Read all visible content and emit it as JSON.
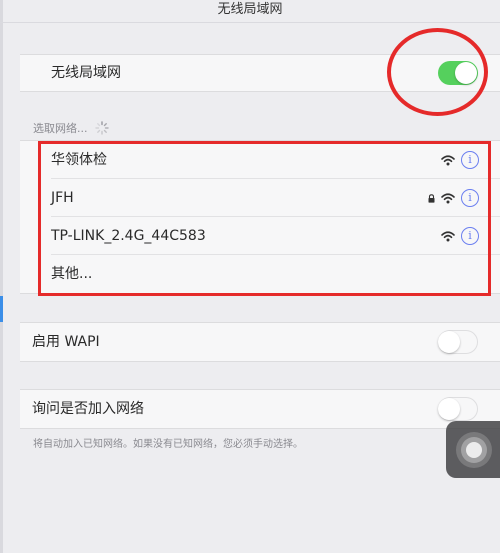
{
  "nav": {
    "title": "无线局域网"
  },
  "wifi_toggle": {
    "label": "无线局域网",
    "on": true
  },
  "networks_section": {
    "header": "选取网络..."
  },
  "networks": [
    {
      "name": "华领体检",
      "locked": false
    },
    {
      "name": "JFH",
      "locked": true
    },
    {
      "name": "TP-LINK_2.4G_44C583",
      "locked": false
    }
  ],
  "other_network": {
    "label": "其他..."
  },
  "wapi": {
    "label": "启用 WAPI",
    "on": false
  },
  "ask_join": {
    "label": "询问是否加入网络",
    "on": false
  },
  "footnote": "将自动加入已知网络。如果没有已知网络，您必须手动选择。",
  "colors": {
    "accent_green": "#55d05d",
    "annotation_red": "#e52a2a",
    "info_blue": "#6b7ff0"
  },
  "icons": {
    "info": "info-icon",
    "wifi": "wifi-signal-icon",
    "lock": "lock-icon",
    "spinner": "loading-spinner-icon"
  },
  "info_glyph": "i"
}
